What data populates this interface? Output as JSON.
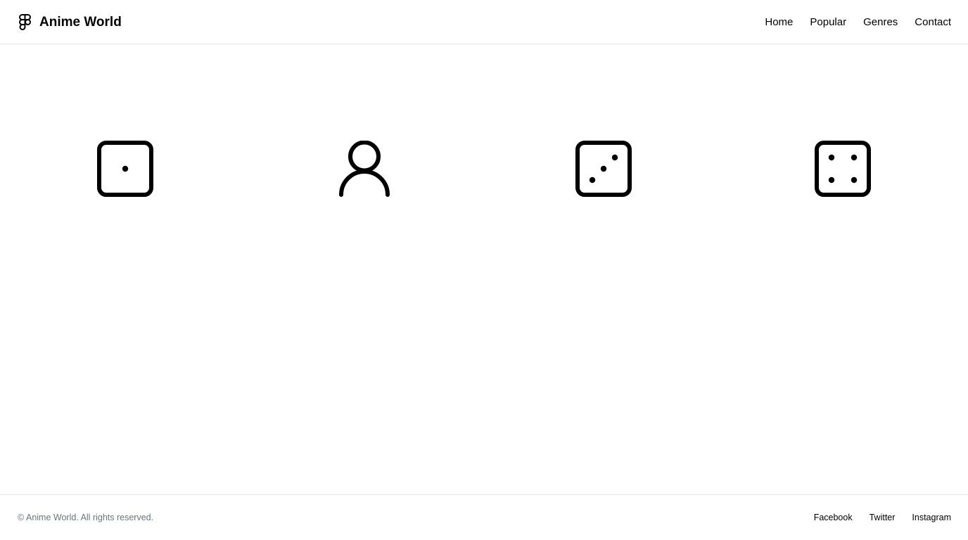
{
  "header": {
    "logo_icon": "figma-logo-icon",
    "title": "Anime World",
    "nav": [
      {
        "label": "Home"
      },
      {
        "label": "Popular"
      },
      {
        "label": "Genres"
      },
      {
        "label": "Contact"
      }
    ]
  },
  "main": {
    "icons": [
      {
        "icon": "dice-one-icon"
      },
      {
        "icon": "user-icon"
      },
      {
        "icon": "dice-three-icon"
      },
      {
        "icon": "dice-four-icon"
      }
    ]
  },
  "footer": {
    "copyright": "© Anime World. All rights reserved.",
    "links": [
      {
        "label": "Facebook"
      },
      {
        "label": "Twitter"
      },
      {
        "label": "Instagram"
      }
    ]
  },
  "colors": {
    "text": "#000000",
    "muted_text": "#6b7280",
    "divider": "#e6e6e6",
    "background": "#ffffff"
  }
}
